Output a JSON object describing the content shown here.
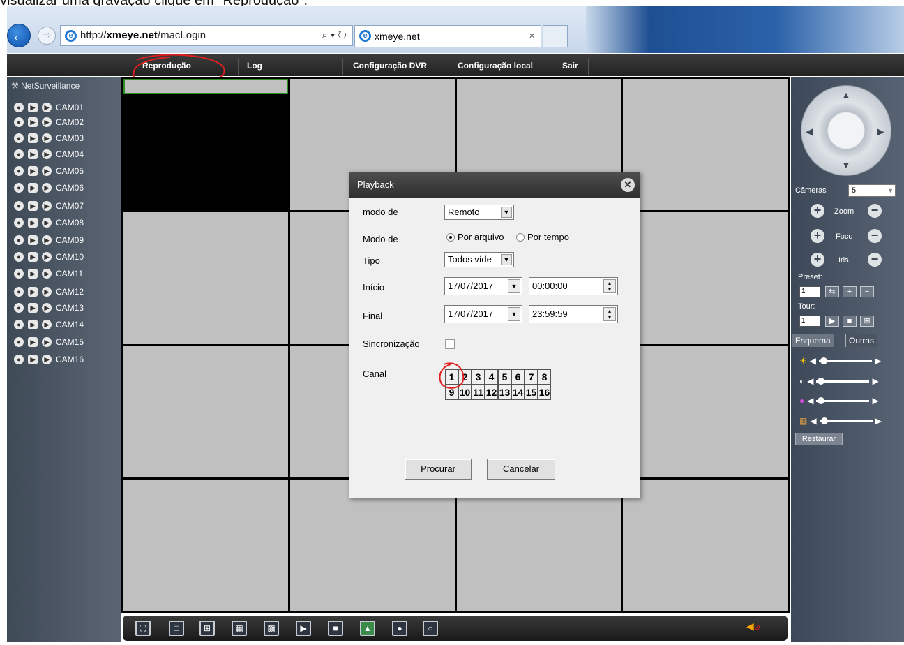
{
  "caption": "visualizar uma gravação clique em \"Reprodução\".",
  "browser": {
    "url_plain": "http://",
    "url_host": "xmeye.net",
    "url_path": "/macLogin",
    "addr_tools": "⌕ ▾ ↻",
    "tab_title": "xmeye.net",
    "tab_close": "×"
  },
  "menu": [
    "Reprodução",
    "Log",
    "Configuração DVR",
    "Configuração local",
    "Sair"
  ],
  "sidebar": {
    "title": "NetSurveillance",
    "cameras": [
      "CAM01",
      "CAM02",
      "CAM03",
      "CAM04",
      "CAM05",
      "CAM06",
      "CAM07",
      "CAM08",
      "CAM09",
      "CAM10",
      "CAM11",
      "CAM12",
      "CAM13",
      "CAM14",
      "CAM15",
      "CAM16"
    ]
  },
  "right_panel": {
    "cameras_label": "Câmeras",
    "cameras_value": "5",
    "zoom_label": "Zoom",
    "focus_label": "Foco",
    "iris_label": "Iris",
    "preset_label": "Preset:",
    "preset_value": "1",
    "tour_label": "Tour:",
    "tour_value": "1",
    "tab_scheme": "Esquema",
    "tab_other": "Outras",
    "restore_label": "Restaurar"
  },
  "dialog": {
    "title": "Playback",
    "mode_label": "modo de",
    "mode_value": "Remoto",
    "search_mode_label": "Modo de",
    "radio_file": "Por arquivo",
    "radio_time": "Por tempo",
    "type_label": "Tipo",
    "type_value": "Todos víde",
    "start_label": "Início",
    "start_date": "17/07/2017",
    "start_time": "00:00:00",
    "end_label": "Final",
    "end_date": "17/07/2017",
    "end_time": "23:59:59",
    "sync_label": "Sincronização",
    "channel_label": "Canal",
    "channels": [
      "1",
      "2",
      "3",
      "4",
      "5",
      "6",
      "7",
      "8",
      "9",
      "10",
      "11",
      "12",
      "13",
      "14",
      "15",
      "16"
    ],
    "search_button": "Procurar",
    "cancel_button": "Cancelar"
  },
  "colors": {
    "annotation": "#e02020",
    "selected_cell": "#2c8e22"
  }
}
